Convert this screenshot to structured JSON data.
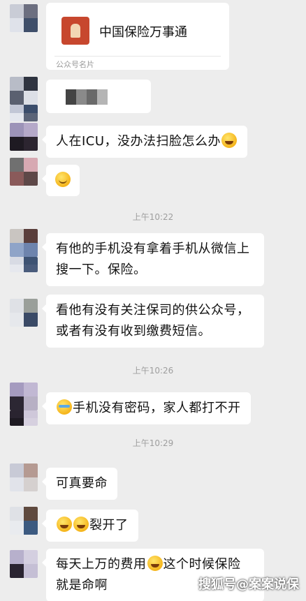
{
  "card": {
    "title": "中国保险万事通",
    "footer": "公众号名片"
  },
  "messages": {
    "m1": "人在ICU，没办法扫脸怎么办",
    "m3a": "有他的手机没有拿着手机从微信上",
    "m3b": "搜一下。保险。",
    "m4a": "看他有没有关注保司的供公众号，",
    "m4b": "或者有没有收到缴费短信。",
    "m5": "手机没有密码，家人都打不开",
    "m6": "可真要命",
    "m7": "裂开了",
    "m8a_pre": "每天上万的费用",
    "m8a_post": "这个时候保险",
    "m8b": "就是命啊"
  },
  "times": {
    "t1": "上午10:22",
    "t2": "上午10:26",
    "t3": "上午10:29"
  },
  "watermark": "搜狐号@案案说保",
  "icons": {
    "laugh_cry": "laughing-crying-emoji",
    "smile": "smiling-emoji",
    "crying": "loudly-crying-emoji"
  },
  "colors": {
    "background": "#ededed",
    "bubble": "#ffffff",
    "timestamp": "#9e9e9e"
  }
}
